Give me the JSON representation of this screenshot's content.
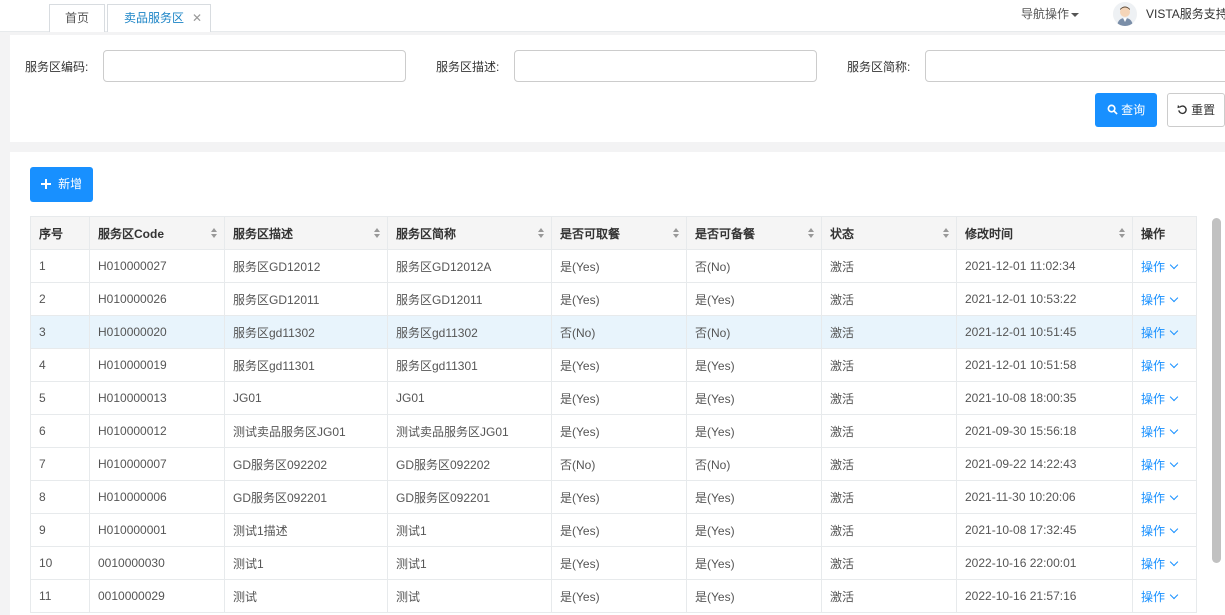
{
  "tabs": {
    "home": "首页",
    "active": "卖品服务区",
    "close": "✕"
  },
  "header": {
    "nav_op": "导航操作",
    "user": "VISTA服务支持"
  },
  "search": {
    "code_label": "服务区编码:",
    "desc_label": "服务区描述:",
    "short_label": "服务区简称:",
    "code_value": "",
    "desc_value": "",
    "short_value": "",
    "search_btn": "查询",
    "reset_btn": "重置"
  },
  "toolbar": {
    "add_btn": "新增"
  },
  "table": {
    "columns": [
      "序号",
      "服务区Code",
      "服务区描述",
      "服务区简称",
      "是否可取餐",
      "是否可备餐",
      "状态",
      "修改时间",
      "操作"
    ],
    "rows": [
      [
        "1",
        "H010000027",
        "服务区GD12012",
        "服务区GD12012A",
        "是(Yes)",
        "否(No)",
        "激活",
        "2021-12-01 11:02:34",
        "操作"
      ],
      [
        "2",
        "H010000026",
        "服务区GD12011",
        "服务区GD12011",
        "是(Yes)",
        "是(Yes)",
        "激活",
        "2021-12-01 10:53:22",
        "操作"
      ],
      [
        "3",
        "H010000020",
        "服务区gd11302",
        "服务区gd11302",
        "否(No)",
        "否(No)",
        "激活",
        "2021-12-01 10:51:45",
        "操作"
      ],
      [
        "4",
        "H010000019",
        "服务区gd11301",
        "服务区gd11301",
        "是(Yes)",
        "是(Yes)",
        "激活",
        "2021-12-01 10:51:58",
        "操作"
      ],
      [
        "5",
        "H010000013",
        "JG01",
        "JG01",
        "是(Yes)",
        "是(Yes)",
        "激活",
        "2021-10-08 18:00:35",
        "操作"
      ],
      [
        "6",
        "H010000012",
        "测试卖品服务区JG01",
        "测试卖品服务区JG01",
        "是(Yes)",
        "是(Yes)",
        "激活",
        "2021-09-30 15:56:18",
        "操作"
      ],
      [
        "7",
        "H010000007",
        "GD服务区092202",
        "GD服务区092202",
        "否(No)",
        "否(No)",
        "激活",
        "2021-09-22 14:22:43",
        "操作"
      ],
      [
        "8",
        "H010000006",
        "GD服务区092201",
        "GD服务区092201",
        "是(Yes)",
        "是(Yes)",
        "激活",
        "2021-11-30 10:20:06",
        "操作"
      ],
      [
        "9",
        "H010000001",
        "测试1描述",
        "测试1",
        "是(Yes)",
        "是(Yes)",
        "激活",
        "2021-10-08 17:32:45",
        "操作"
      ],
      [
        "10",
        "0010000030",
        "测试1",
        "测试1",
        "是(Yes)",
        "是(Yes)",
        "激活",
        "2022-10-16 22:00:01",
        "操作"
      ],
      [
        "11",
        "0010000029",
        "测试",
        "测试",
        "是(Yes)",
        "是(Yes)",
        "激活",
        "2022-10-16 21:57:16",
        "操作"
      ]
    ]
  },
  "colors": {
    "primary": "#1890ff",
    "tab_active": "#1c84c6",
    "row_highlight": "#e8f4fc"
  }
}
